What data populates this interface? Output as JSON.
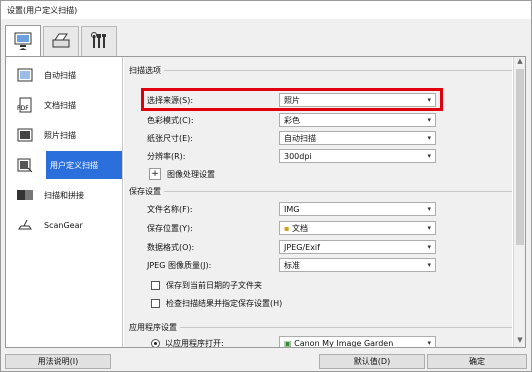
{
  "window": {
    "title": "设置(用户定义扫描)"
  },
  "tabs": [
    {
      "icon": "scan-tab-icon"
    },
    {
      "icon": "scanner-tab-icon"
    },
    {
      "icon": "tools-tab-icon"
    }
  ],
  "sidebar": {
    "items": [
      {
        "label": "自动扫描",
        "icon": "auto-scan-icon"
      },
      {
        "label": "文档扫描",
        "icon": "document-scan-icon"
      },
      {
        "label": "照片扫描",
        "icon": "photo-scan-icon"
      },
      {
        "label": "用户定义扫描",
        "icon": "custom-scan-icon"
      },
      {
        "label": "扫描和拼接",
        "icon": "stitch-icon"
      },
      {
        "label": "ScanGear",
        "icon": "scangear-icon"
      }
    ]
  },
  "scan_options": {
    "title": "扫描选项",
    "rows": [
      {
        "label": "选择来源(S):",
        "value": "照片"
      },
      {
        "label": "色彩模式(C):",
        "value": "彩色"
      },
      {
        "label": "纸张尺寸(E):",
        "value": "自动扫描"
      },
      {
        "label": "分辨率(R):",
        "value": "300dpi"
      }
    ],
    "image_processing": "图像处理设置"
  },
  "save_settings": {
    "title": "保存设置",
    "rows": [
      {
        "label": "文件名称(F):",
        "value": "IMG"
      },
      {
        "label": "保存位置(Y):",
        "value": "文档"
      },
      {
        "label": "数据格式(O):",
        "value": "JPEG/Exif"
      },
      {
        "label": "JPEG 图像质量(J):",
        "value": "标准"
      }
    ],
    "check1": "保存到当前日期的子文件夹",
    "check2": "检查扫描结果并指定保存设置(H)"
  },
  "app_settings": {
    "title": "应用程序设置",
    "open_with": "以应用程序打开:",
    "app": "Canon My Image Garden"
  },
  "buttons": {
    "help": "用法说明(I)",
    "defaults": "默认值(D)",
    "ok": "确定"
  }
}
